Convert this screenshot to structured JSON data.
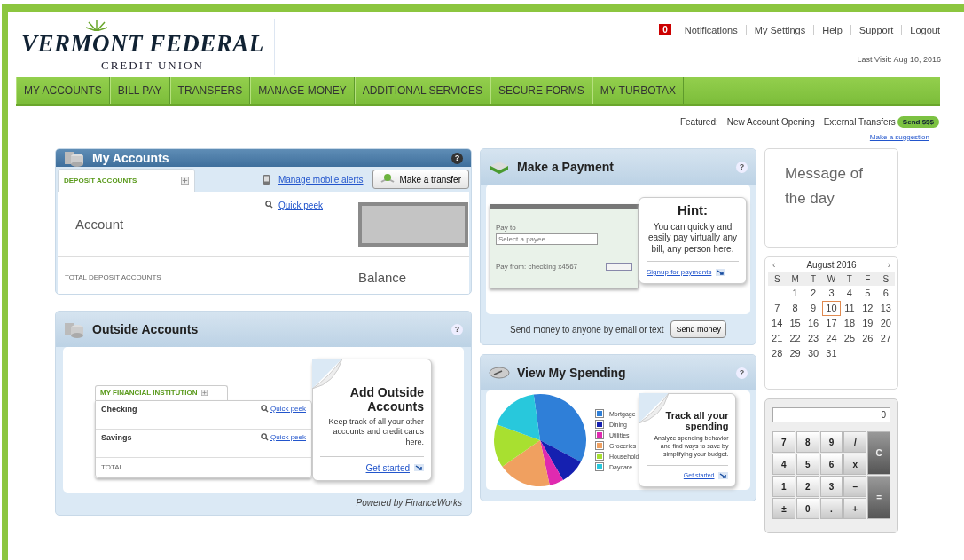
{
  "logo": {
    "name": "VERMONT FEDERAL",
    "subtitle": "CREDIT UNION"
  },
  "top_links": {
    "notifications": {
      "count": "0",
      "label": "Notifications"
    },
    "links": [
      "My Settings",
      "Help",
      "Support",
      "Logout"
    ]
  },
  "last_visit": "Last Visit: Aug 10, 2016",
  "nav": [
    "MY ACCOUNTS",
    "BILL PAY",
    "TRANSFERS",
    "MANAGE MONEY",
    "ADDITIONAL SERVICES",
    "SECURE FORMS",
    "MY TURBOTAX"
  ],
  "featured": {
    "label": "Featured:",
    "links": [
      "New Account Opening",
      "External Transfers"
    ],
    "badge": "Send $$$",
    "suggestion": "Make a suggestion"
  },
  "my_accounts": {
    "title": "My Accounts",
    "help": "?",
    "tab": "DEPOSIT ACCOUNTS",
    "alerts_link": "Manage mobile alerts",
    "transfer_button": "Make a transfer",
    "account_label": "Account",
    "quick_peek": "Quick peek",
    "total_label": "TOTAL DEPOSIT ACCOUNTS",
    "balance_label": "Balance"
  },
  "outside_accounts": {
    "title": "Outside Accounts",
    "help": "?",
    "tab": "MY FINANCIAL INSTITUTION",
    "rows": [
      {
        "name": "Checking",
        "link": "Quick peek"
      },
      {
        "name": "Savings",
        "link": "Quick peek"
      }
    ],
    "total_label": "TOTAL",
    "callout": {
      "title": "Add Outside Accounts",
      "text": "Keep track of all your other accounts and credit cards here.",
      "link": "Get started"
    },
    "footer": "Powered by FinanceWorks"
  },
  "make_payment": {
    "title": "Make a Payment",
    "help": "?",
    "check": {
      "pay_to": "Pay to",
      "payee_placeholder": "Select a payee",
      "pay_from": "Pay from: checking x4567"
    },
    "hint": {
      "title": "Hint:",
      "text": "You can quickly and easily pay virtually any bill, any person here.",
      "link": "Signup for payments"
    },
    "send_text": "Send money to anyone by email or text",
    "send_button": "Send money"
  },
  "spending": {
    "title": "View My Spending",
    "help": "?",
    "legend": [
      {
        "label": "Mortgage",
        "color": "#2f7fd8"
      },
      {
        "label": "Dining",
        "color": "#1520b0"
      },
      {
        "label": "Utilities",
        "color": "#e02ab0"
      },
      {
        "label": "Groceries",
        "color": "#f0a060"
      },
      {
        "label": "Household",
        "color": "#a8e030"
      },
      {
        "label": "Daycare",
        "color": "#28c8dc"
      }
    ],
    "callout": {
      "title": "Track all your spending",
      "text": "Analyze spending behavior and find ways to save by simplifying your budget.",
      "link": "Get started"
    }
  },
  "message_of_the_day": "Message of the day",
  "calendar": {
    "prev": "‹",
    "month": "August 2016",
    "next": "›",
    "weekdays": [
      "S",
      "M",
      "T",
      "W",
      "T",
      "F",
      "S"
    ],
    "weeks": [
      [
        {
          "day": "1",
          "selected": false
        },
        {
          "day": "2",
          "selected": false
        },
        {
          "day": "3",
          "selected": false
        },
        {
          "day": "4",
          "selected": false
        },
        {
          "day": "5",
          "selected": false
        },
        {
          "day": "6",
          "selected": false
        }
      ],
      [
        {
          "day": "7",
          "selected": false
        },
        {
          "day": "8",
          "selected": false
        },
        {
          "day": "9",
          "selected": false
        },
        {
          "day": "10",
          "selected": true
        },
        {
          "day": "11",
          "selected": false
        },
        {
          "day": "12",
          "selected": false
        },
        {
          "day": "13",
          "selected": false
        }
      ],
      [
        {
          "day": "14",
          "selected": false
        },
        {
          "day": "15",
          "selected": false
        },
        {
          "day": "16",
          "selected": false
        },
        {
          "day": "17",
          "selected": false
        },
        {
          "day": "18",
          "selected": false
        },
        {
          "day": "19",
          "selected": false
        },
        {
          "day": "20",
          "selected": false
        }
      ],
      [
        {
          "day": "21",
          "selected": false
        },
        {
          "day": "22",
          "selected": false
        },
        {
          "day": "23",
          "selected": false
        },
        {
          "day": "24",
          "selected": false
        },
        {
          "day": "25",
          "selected": false
        },
        {
          "day": "26",
          "selected": false
        },
        {
          "day": "27",
          "selected": false
        }
      ],
      [
        {
          "day": "28",
          "selected": false
        },
        {
          "day": "29",
          "selected": false
        },
        {
          "day": "30",
          "selected": false
        },
        {
          "day": "31",
          "selected": false
        }
      ]
    ]
  },
  "calculator": {
    "display": "0",
    "keys": [
      {
        "label": "7",
        "kind": "digit"
      },
      {
        "label": "8",
        "kind": "digit"
      },
      {
        "label": "9",
        "kind": "digit"
      },
      {
        "label": "/",
        "kind": "op"
      },
      {
        "label": "C",
        "kind": "action"
      },
      {
        "label": "4",
        "kind": "digit"
      },
      {
        "label": "5",
        "kind": "digit"
      },
      {
        "label": "6",
        "kind": "digit"
      },
      {
        "label": "x",
        "kind": "op"
      },
      {
        "label": "1",
        "kind": "digit"
      },
      {
        "label": "2",
        "kind": "digit"
      },
      {
        "label": "3",
        "kind": "digit"
      },
      {
        "label": "–",
        "kind": "op"
      },
      {
        "label": "=",
        "kind": "action"
      },
      {
        "label": "±",
        "kind": "op"
      },
      {
        "label": "0",
        "kind": "digit"
      },
      {
        "label": ".",
        "kind": "op"
      },
      {
        "label": "+",
        "kind": "op"
      }
    ]
  }
}
